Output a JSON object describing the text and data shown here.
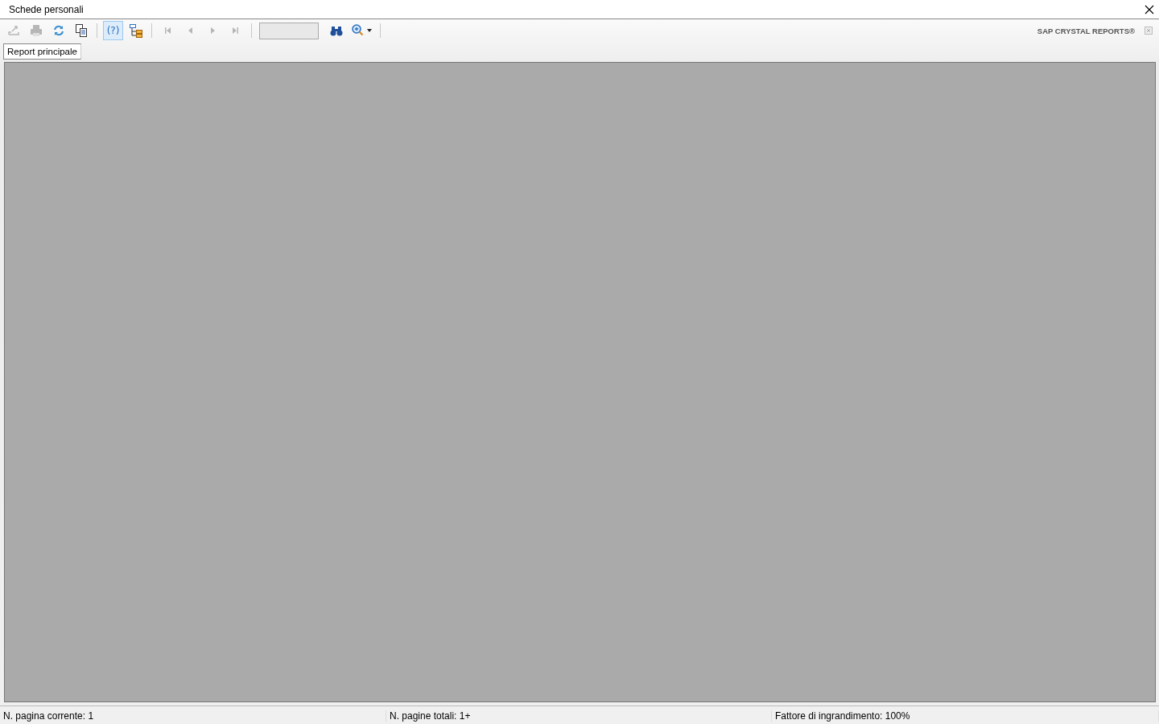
{
  "window": {
    "title": "Schede personali"
  },
  "toolbar": {
    "buttons": [
      {
        "kind": "export",
        "disabled": true,
        "selected": false
      },
      {
        "kind": "print",
        "disabled": true,
        "selected": false
      },
      {
        "kind": "refresh",
        "disabled": false,
        "selected": false
      },
      {
        "kind": "copy",
        "disabled": false,
        "selected": false
      },
      {
        "kind": "sep"
      },
      {
        "kind": "help",
        "label": "(?)",
        "disabled": false,
        "selected": true
      },
      {
        "kind": "tree",
        "disabled": false,
        "selected": false
      },
      {
        "kind": "sep"
      },
      {
        "kind": "first",
        "disabled": true,
        "selected": false
      },
      {
        "kind": "prev",
        "disabled": true,
        "selected": false
      },
      {
        "kind": "next",
        "disabled": true,
        "selected": false
      },
      {
        "kind": "last",
        "disabled": true,
        "selected": false
      },
      {
        "kind": "sep"
      },
      {
        "kind": "page-field"
      },
      {
        "kind": "find",
        "disabled": false,
        "selected": false
      },
      {
        "kind": "zoom",
        "disabled": false,
        "selected": false
      },
      {
        "kind": "sep"
      }
    ],
    "brand": "SAP CRYSTAL REPORTS®"
  },
  "tabs": [
    {
      "label": "Report principale",
      "selected": true
    }
  ],
  "status_bar": [
    "N. pagina corrente: 1",
    "N. pagine totali: 1+",
    "Fattore di ingrandimento: 100%"
  ]
}
